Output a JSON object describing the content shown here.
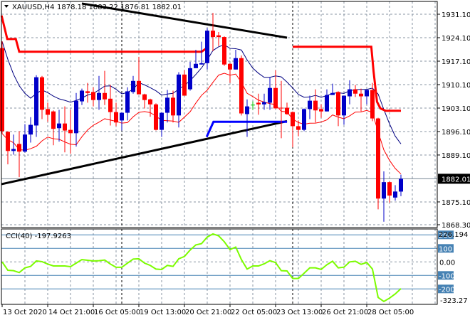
{
  "header": {
    "menu_icon": "triangle-down-icon",
    "symbol": "XAUUSD,H4",
    "ohlc": "1878.18 1883.22 1876.81 1882.01"
  },
  "colors": {
    "bull": "#0000C8",
    "bear": "#FF0000",
    "ma_high": "#000080",
    "ma_low": "#FF0000",
    "cci": "#7CFC00",
    "level": "#4682B4",
    "grid": "#8A96A3"
  },
  "price_axis": {
    "labels": [
      "1931.10",
      "1924.10",
      "1917.10",
      "1910.10",
      "1903.10",
      "1896.10",
      "1889.10",
      "1875.10",
      "1868.30"
    ],
    "current_price": "1882.01",
    "range": [
      1868.3,
      1931.1
    ]
  },
  "cci_axis": {
    "legend": "CCI(40) -197.9263",
    "max_label": "226.194",
    "min_label": "-323.27",
    "zero_label": "0.00",
    "level_labels": [
      "200",
      "100",
      "-100",
      "-200"
    ],
    "levels": [
      200,
      100,
      -100,
      -200
    ],
    "range": [
      -323.27,
      226.194
    ]
  },
  "time_axis": {
    "labels": [
      "13 Oct 2020",
      "14 Oct 21:00",
      "16 Oct 05:00",
      "19 Oct 13:00",
      "20 Oct 21:00",
      "22 Oct 05:00",
      "23 Oct 13:00",
      "26 Oct 21:00",
      "28 Oct 05:00"
    ],
    "label_bar_index": [
      0,
      8,
      16,
      24,
      32,
      40,
      48,
      56,
      64
    ]
  },
  "candles": [
    [
      1921.0,
      1923.0,
      1895.5,
      1896.2
    ],
    [
      1896.0,
      1896.2,
      1886.3,
      1890.3
    ],
    [
      1890.3,
      1895.2,
      1889.2,
      1890.9
    ],
    [
      1892.4,
      1896.2,
      1882.5,
      1890.1
    ],
    [
      1890.1,
      1898.3,
      1889.8,
      1895.2
    ],
    [
      1895.2,
      1900.4,
      1892.8,
      1898.1
    ],
    [
      1897.9,
      1912.9,
      1894.5,
      1912.3
    ],
    [
      1912.3,
      1912.7,
      1899.8,
      1902.6
    ],
    [
      1902.8,
      1904.7,
      1899.0,
      1901.1
    ],
    [
      1902.1,
      1902.4,
      1892.0,
      1896.9
    ],
    [
      1897.1,
      1902.6,
      1893.1,
      1898.5
    ],
    [
      1898.5,
      1903.6,
      1889.9,
      1896.4
    ],
    [
      1896.6,
      1902.6,
      1889.5,
      1895.6
    ],
    [
      1895.6,
      1907.6,
      1891.6,
      1905.3
    ],
    [
      1905.1,
      1908.9,
      1904.0,
      1908.3
    ],
    [
      1908.1,
      1910.6,
      1904.7,
      1907.6
    ],
    [
      1907.9,
      1909.3,
      1903.6,
      1905.5
    ],
    [
      1905.5,
      1912.7,
      1902.6,
      1907.6
    ],
    [
      1907.6,
      1914.2,
      1904.0,
      1905.7
    ],
    [
      1905.9,
      1910.0,
      1897.9,
      1901.9
    ],
    [
      1901.9,
      1904.7,
      1897.7,
      1898.8
    ],
    [
      1899.4,
      1901.9,
      1896.4,
      1901.7
    ],
    [
      1901.7,
      1909.3,
      1899.4,
      1908.1
    ],
    [
      1907.9,
      1912.7,
      1907.4,
      1911.2
    ],
    [
      1911.2,
      1918.4,
      1907.2,
      1907.2
    ],
    [
      1907.2,
      1907.4,
      1903.0,
      1905.5
    ],
    [
      1905.7,
      1905.9,
      1900.5,
      1904.2
    ],
    [
      1904.2,
      1904.5,
      1896.4,
      1896.6
    ],
    [
      1896.6,
      1901.9,
      1894.5,
      1901.7
    ],
    [
      1901.7,
      1908.5,
      1898.8,
      1906.2
    ],
    [
      1906.2,
      1908.3,
      1898.8,
      1900.9
    ],
    [
      1900.9,
      1913.8,
      1897.3,
      1913.1
    ],
    [
      1913.1,
      1914.4,
      1906.8,
      1906.8
    ],
    [
      1908.7,
      1916.9,
      1908.3,
      1915.0
    ],
    [
      1915.0,
      1920.5,
      1915.0,
      1916.3
    ],
    [
      1916.1,
      1922.9,
      1916.1,
      1916.5
    ],
    [
      1916.5,
      1927.0,
      1914.6,
      1926.2
    ],
    [
      1926.2,
      1931.5,
      1920.1,
      1924.3
    ],
    [
      1924.8,
      1925.8,
      1921.6,
      1924.3
    ],
    [
      1924.3,
      1924.5,
      1915.7,
      1916.1
    ],
    [
      1916.3,
      1916.5,
      1910.6,
      1914.6
    ],
    [
      1914.6,
      1920.5,
      1914.6,
      1918.0
    ],
    [
      1918.0,
      1918.8,
      1900.9,
      1901.5
    ],
    [
      1901.3,
      1905.7,
      1894.5,
      1903.6
    ],
    [
      1904.0,
      1905.1,
      1902.6,
      1904.0
    ],
    [
      1904.7,
      1907.4,
      1901.1,
      1904.2
    ],
    [
      1904.2,
      1907.4,
      1902.6,
      1904.9
    ],
    [
      1904.7,
      1912.3,
      1902.6,
      1909.1
    ],
    [
      1909.1,
      1914.4,
      1903.0,
      1903.0
    ],
    [
      1903.2,
      1911.2,
      1894.1,
      1903.0
    ],
    [
      1903.2,
      1904.7,
      1901.1,
      1901.3
    ],
    [
      1901.9,
      1902.1,
      1891.4,
      1897.7
    ],
    [
      1897.7,
      1899.4,
      1894.7,
      1896.6
    ],
    [
      1896.6,
      1903.0,
      1896.2,
      1902.8
    ],
    [
      1902.8,
      1906.8,
      1899.8,
      1905.3
    ],
    [
      1905.3,
      1908.7,
      1898.8,
      1902.4
    ],
    [
      1902.8,
      1904.2,
      1900.2,
      1902.1
    ],
    [
      1902.1,
      1908.7,
      1902.1,
      1907.0
    ],
    [
      1907.0,
      1910.4,
      1907.0,
      1907.6
    ],
    [
      1907.9,
      1908.1,
      1897.7,
      1900.9
    ],
    [
      1900.9,
      1906.8,
      1898.1,
      1906.8
    ],
    [
      1906.6,
      1911.4,
      1904.2,
      1908.7
    ],
    [
      1908.7,
      1910.0,
      1906.4,
      1907.4
    ],
    [
      1907.4,
      1908.9,
      1902.1,
      1906.6
    ],
    [
      1906.6,
      1908.7,
      1904.2,
      1908.5
    ],
    [
      1908.5,
      1910.6,
      1899.2,
      1900.0
    ],
    [
      1900.0,
      1900.2,
      1872.9,
      1876.1
    ],
    [
      1876.1,
      1884.2,
      1869.2,
      1881.0
    ],
    [
      1881.0,
      1881.2,
      1874.9,
      1877.0
    ],
    [
      1876.4,
      1880.1,
      1875.5,
      1878.2
    ],
    [
      1878.18,
      1883.22,
      1876.81,
      1882.01
    ]
  ],
  "cci_values": [
    0,
    -62,
    -65,
    -79,
    -44,
    -33,
    7,
    2,
    -16,
    -30,
    -30,
    -30,
    -35,
    -9,
    17,
    12,
    7,
    9,
    14,
    -16,
    -40,
    -40,
    -9,
    21,
    23,
    -9,
    -26,
    -53,
    -56,
    -26,
    -33,
    23,
    40,
    88,
    126,
    135,
    184,
    207,
    193,
    149,
    91,
    110,
    17,
    -53,
    -30,
    -30,
    -14,
    9,
    -5,
    -65,
    -67,
    -123,
    -123,
    -84,
    -44,
    -44,
    -56,
    -21,
    5,
    -44,
    -39,
    0,
    5,
    -18,
    -4,
    -53,
    -263,
    -293,
    -268,
    -237,
    -198
  ],
  "drawings": {
    "trendlines": [
      {
        "name": "lower-trendline",
        "color": "#000000",
        "points": [
          [
            -0.1,
            1880.4
          ],
          [
            50,
            1899.2
          ]
        ]
      },
      {
        "name": "upper-trendline",
        "color": "#000000",
        "points": [
          [
            14,
            1934.3
          ],
          [
            50,
            1924.1
          ]
        ]
      },
      {
        "name": "blue-support-line",
        "color": "#0000FF",
        "points": [
          [
            35.9,
            1894.5
          ],
          [
            37.1,
            1899.0
          ],
          [
            50,
            1899.0
          ]
        ]
      },
      {
        "name": "red-step-line-1",
        "color": "#FF0000",
        "points": [
          [
            -0.1,
            1930.7
          ],
          [
            0.9,
            1923.7
          ],
          [
            2.4,
            1923.7
          ],
          [
            3,
            1919.9
          ],
          [
            35,
            1919.9
          ],
          [
            35.9,
            1921.0
          ]
        ]
      },
      {
        "name": "red-step-line-2",
        "color": "#FF0000",
        "points": [
          [
            51,
            1921.4
          ],
          [
            64.8,
            1921.4
          ],
          [
            65.2,
            1914
          ],
          [
            65.8,
            1905
          ],
          [
            66.4,
            1903.0
          ],
          [
            67.3,
            1902.3
          ],
          [
            70,
            1902.3
          ]
        ]
      }
    ],
    "separator_bar_index": [
      21,
      51
    ]
  }
}
